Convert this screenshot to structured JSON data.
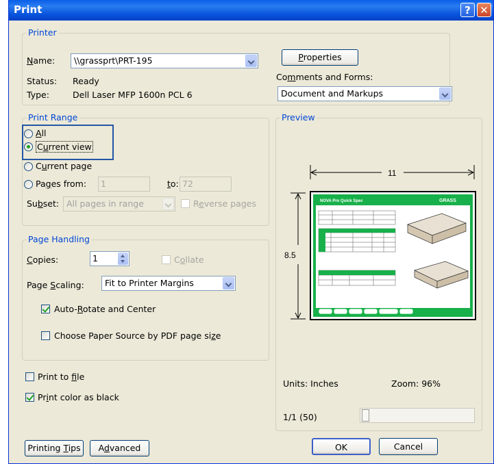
{
  "window": {
    "title": "Print",
    "help_glyph": "?",
    "close_glyph": "✕"
  },
  "printer": {
    "legend": "Printer",
    "name_label": "Name:",
    "name_value": "\\\\grassprt\\PRT-195",
    "status_label": "Status:",
    "status_value": "Ready",
    "type_label": "Type:",
    "type_value": "Dell Laser MFP 1600n PCL 6",
    "properties_button": "Properties",
    "comments_label": "Comments and Forms:",
    "comments_value": "Document and Markups"
  },
  "print_range": {
    "legend": "Print Range",
    "all": "All",
    "current_view": "Current view",
    "current_page": "Current page",
    "pages_label": "Pages from:",
    "pages_from": "1",
    "to_label": "to:",
    "pages_to": "72",
    "subset_label": "Subset:",
    "subset_value": "All pages in range",
    "reverse_pages": "Reverse pages",
    "selected": "current_view"
  },
  "page_handling": {
    "legend": "Page Handling",
    "copies_label": "Copies:",
    "copies_value": "1",
    "collate": "Collate",
    "scaling_label": "Page Scaling:",
    "scaling_value": "Fit to Printer Margins",
    "auto_rotate": "Auto-Rotate and Center",
    "auto_rotate_checked": true,
    "choose_source": "Choose Paper Source by PDF page size",
    "choose_source_checked": false
  },
  "options": {
    "print_to_file": "Print to file",
    "print_to_file_checked": false,
    "print_color_black": "Print color as black",
    "print_color_black_checked": true
  },
  "preview": {
    "legend": "Preview",
    "width_label": "11",
    "height_label": "8.5",
    "page_title": "NOVA Pro Quick Spec",
    "page_brand": "GRASS",
    "units": "Units: Inches",
    "zoom": "Zoom:  96%",
    "page_counter": "1/1 (50)"
  },
  "buttons": {
    "printing_tips": "Printing Tips",
    "advanced": "Advanced",
    "ok": "OK",
    "cancel": "Cancel"
  },
  "colors": {
    "title_bar": "#0a5fe8",
    "group_label": "#0046d5",
    "highlight_box": "#2255a4",
    "preview_green": "#18b04a"
  }
}
